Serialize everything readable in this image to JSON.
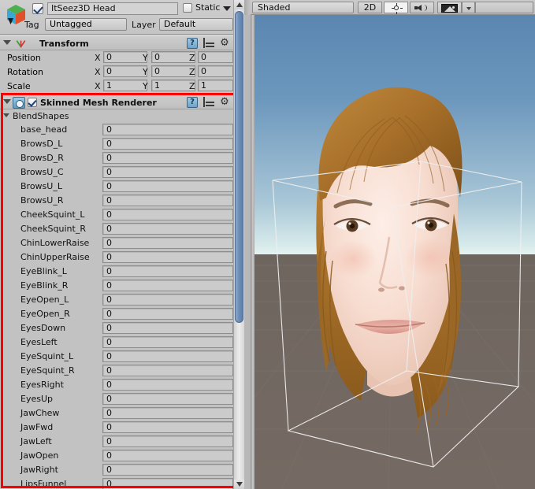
{
  "inspector": {
    "object_header": {
      "icon": "prefab-cube-icon",
      "enabled_checkbox": true,
      "name": "ItSeez3D Head",
      "static_label": "Static",
      "static_checked": false,
      "tag_label": "Tag",
      "tag_value": "Untagged",
      "layer_label": "Layer",
      "layer_value": "Default"
    },
    "transform": {
      "title": "Transform",
      "expanded": true,
      "icons": [
        "help-book-icon",
        "preset-icon",
        "gear-icon"
      ],
      "rows": [
        {
          "label": "Position",
          "x": "0",
          "y": "0",
          "z": "0"
        },
        {
          "label": "Rotation",
          "x": "0",
          "y": "0",
          "z": "0"
        },
        {
          "label": "Scale",
          "x": "1",
          "y": "1",
          "z": "1"
        }
      ],
      "axis_labels": {
        "x": "X",
        "y": "Y",
        "z": "Z"
      }
    },
    "skinned_mesh_renderer": {
      "title": "Skinned Mesh Renderer",
      "enabled_checkbox": true,
      "expanded": true,
      "icons": [
        "help-book-icon",
        "preset-icon",
        "gear-icon"
      ],
      "blendshapes_label": "BlendShapes",
      "blendshapes": [
        {
          "name": "base_head",
          "value": "0"
        },
        {
          "name": "BrowsD_L",
          "value": "0"
        },
        {
          "name": "BrowsD_R",
          "value": "0"
        },
        {
          "name": "BrowsU_C",
          "value": "0"
        },
        {
          "name": "BrowsU_L",
          "value": "0"
        },
        {
          "name": "BrowsU_R",
          "value": "0"
        },
        {
          "name": "CheekSquint_L",
          "value": "0"
        },
        {
          "name": "CheekSquint_R",
          "value": "0"
        },
        {
          "name": "ChinLowerRaise",
          "value": "0"
        },
        {
          "name": "ChinUpperRaise",
          "value": "0"
        },
        {
          "name": "EyeBlink_L",
          "value": "0"
        },
        {
          "name": "EyeBlink_R",
          "value": "0"
        },
        {
          "name": "EyeOpen_L",
          "value": "0"
        },
        {
          "name": "EyeOpen_R",
          "value": "0"
        },
        {
          "name": "EyesDown",
          "value": "0"
        },
        {
          "name": "EyesLeft",
          "value": "0"
        },
        {
          "name": "EyeSquint_L",
          "value": "0"
        },
        {
          "name": "EyeSquint_R",
          "value": "0"
        },
        {
          "name": "EyesRight",
          "value": "0"
        },
        {
          "name": "EyesUp",
          "value": "0"
        },
        {
          "name": "JawChew",
          "value": "0"
        },
        {
          "name": "JawFwd",
          "value": "0"
        },
        {
          "name": "JawLeft",
          "value": "0"
        },
        {
          "name": "JawOpen",
          "value": "0"
        },
        {
          "name": "JawRight",
          "value": "0"
        },
        {
          "name": "LipsFunnel",
          "value": "0"
        }
      ]
    },
    "highlight_color": "#ff0000",
    "scrollbar": {
      "up_arrow": "▲",
      "down_arrow": "▼"
    }
  },
  "scene": {
    "toolbar": {
      "shading_mode": "Shaded",
      "mode_2d": "2D",
      "lighting_icon": "sun-icon",
      "audio_icon": "speaker-icon",
      "gizmos_icon": "image-gizmo-icon",
      "gizmos_dropdown_icon": "chevron-down-icon"
    },
    "content": {
      "description": "3D head model with auburn hair in scene view",
      "sky_color_top": "#5b86b0",
      "sky_color_horizon": "#e0efed",
      "ground_color": "#736860",
      "selection_wire_color": "#e8e8e8",
      "hair_color": "#a5712c",
      "skin_color": "#f4d8cc"
    }
  }
}
